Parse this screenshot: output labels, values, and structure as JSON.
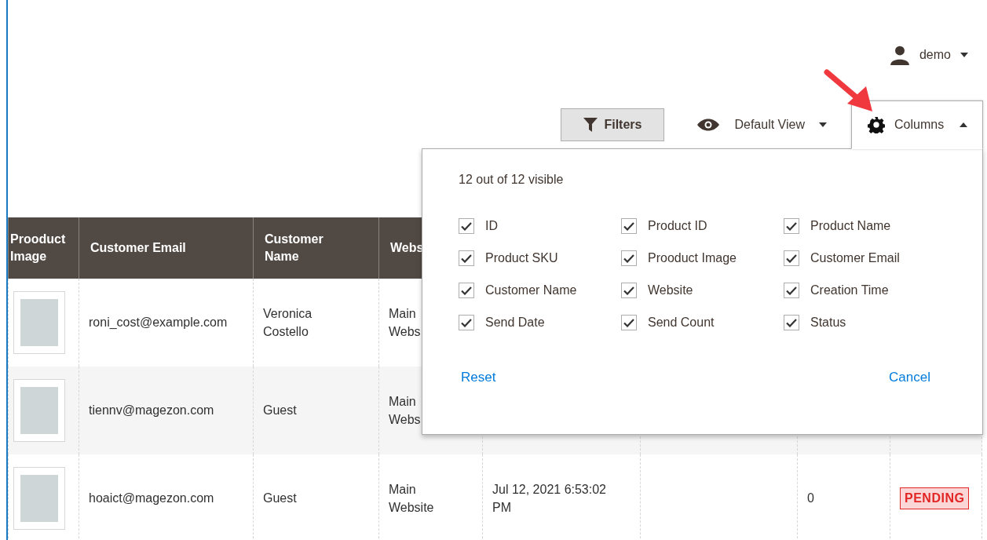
{
  "user": {
    "name": "demo"
  },
  "toolbar": {
    "filters": "Filters",
    "view": "Default View",
    "columns": "Columns",
    "columns_expanded": true
  },
  "columns_panel": {
    "summary": "12 out of 12 visible",
    "options": [
      {
        "label": "ID",
        "checked": true
      },
      {
        "label": "Product ID",
        "checked": true
      },
      {
        "label": "Product Name",
        "checked": true
      },
      {
        "label": "Product SKU",
        "checked": true
      },
      {
        "label": "Prooduct Image",
        "checked": true
      },
      {
        "label": "Customer Email",
        "checked": true
      },
      {
        "label": "Customer Name",
        "checked": true
      },
      {
        "label": "Website",
        "checked": true
      },
      {
        "label": "Creation Time",
        "checked": true
      },
      {
        "label": "Send Date",
        "checked": true
      },
      {
        "label": "Send Count",
        "checked": true
      },
      {
        "label": "Status",
        "checked": true
      }
    ],
    "reset": "Reset",
    "cancel": "Cancel"
  },
  "table": {
    "columns": [
      "Prooduct Image",
      "Customer Email",
      "Customer Name",
      "Webs"
    ],
    "rows": [
      {
        "cells": [
          {
            "kind": "image"
          },
          {
            "kind": "text",
            "text": "roni_cost@example.com"
          },
          {
            "kind": "text",
            "text": "Veronica Costello"
          },
          {
            "kind": "text",
            "text": "Main Webs"
          }
        ]
      },
      {
        "cells": [
          {
            "kind": "image"
          },
          {
            "kind": "text",
            "text": "tiennv@magezon.com"
          },
          {
            "kind": "text",
            "text": "Guest"
          },
          {
            "kind": "text",
            "text": "Main Webs"
          }
        ]
      },
      {
        "cells": [
          {
            "kind": "image"
          },
          {
            "kind": "text",
            "text": "hoaict@magezon.com"
          },
          {
            "kind": "text",
            "text": "Guest"
          },
          {
            "kind": "text",
            "text": "Main Website"
          },
          {
            "kind": "text",
            "text": "Jul 12, 2021 6:53:02 PM"
          },
          {
            "kind": "empty"
          },
          {
            "kind": "text",
            "text": "0"
          },
          {
            "kind": "status",
            "text": "PENDING"
          }
        ]
      }
    ]
  }
}
